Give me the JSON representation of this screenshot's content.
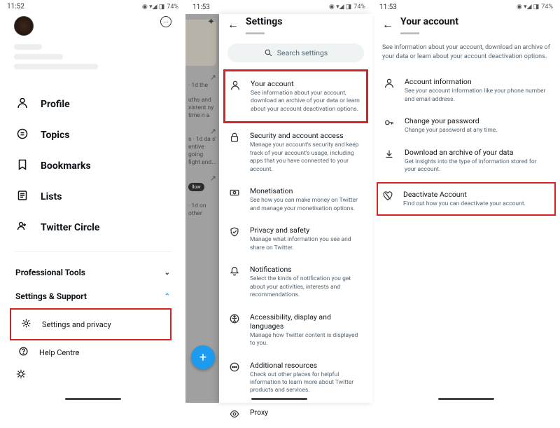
{
  "status": {
    "time1": "11:52",
    "time2": "11:53",
    "time3": "11:53",
    "battery": "74%",
    "icons": "◉ ▾◢ ◨"
  },
  "screen1": {
    "nav": [
      {
        "icon": "person",
        "label": "Profile"
      },
      {
        "icon": "topic",
        "label": "Topics"
      },
      {
        "icon": "bookmark",
        "label": "Bookmarks"
      },
      {
        "icon": "list",
        "label": "Lists"
      },
      {
        "icon": "circle",
        "label": "Twitter Circle"
      }
    ],
    "pro": "Professional Tools",
    "sup": "Settings & Support",
    "settings_privacy": "Settings and privacy",
    "help": "Help Centre"
  },
  "sliver": {
    "feed": [
      "· 1d\nthe",
      "uths and\nxistent\nny time\nn a",
      "s · 1d\nda\ns'\nentive\ngoing\nfight\nand...",
      "llow",
      "· 1d\non other"
    ]
  },
  "screen2": {
    "title": "Settings",
    "search": "Search settings",
    "rows": [
      {
        "key": "account",
        "icon": "person",
        "title": "Your account",
        "desc": "See information about your account, download an archive of your data or learn about your account deactivation options."
      },
      {
        "key": "security",
        "icon": "lock",
        "title": "Security and account access",
        "desc": "Manage your account's security and keep track of your account's usage, including apps that you have connected to your account."
      },
      {
        "key": "monetisation",
        "icon": "cash",
        "title": "Monetisation",
        "desc": "See how you can make money on Twitter and manage your monetisation options."
      },
      {
        "key": "privacy",
        "icon": "shield",
        "title": "Privacy and safety",
        "desc": "Manage what information you see and share on Twitter."
      },
      {
        "key": "notifications",
        "icon": "bell",
        "title": "Notifications",
        "desc": "Select the kinds of notification you get about your activities, interests and recommendations."
      },
      {
        "key": "accessibility",
        "icon": "a11y",
        "title": "Accessibility, display and languages",
        "desc": "Manage how Twitter content is displayed to you."
      },
      {
        "key": "additional",
        "icon": "dots",
        "title": "Additional resources",
        "desc": "Check out other places for helpful information to learn more about Twitter products and services."
      },
      {
        "key": "proxy",
        "icon": "eye",
        "title": "Proxy",
        "desc": ""
      }
    ]
  },
  "screen3": {
    "title": "Your account",
    "intro": "See information about your account, download an archive of your data or learn about your account deactivation options.",
    "rows": [
      {
        "key": "info",
        "icon": "person",
        "title": "Account information",
        "desc": "See your account information like your phone number and email address."
      },
      {
        "key": "password",
        "icon": "key",
        "title": "Change your password",
        "desc": "Change your password at any time."
      },
      {
        "key": "download",
        "icon": "download",
        "title": "Download an archive of your data",
        "desc": "Get insights into the type of information stored for your account."
      },
      {
        "key": "deactivate",
        "icon": "heartbreak",
        "title": "Deactivate Account",
        "desc": "Find out how you can deactivate your account."
      }
    ]
  }
}
